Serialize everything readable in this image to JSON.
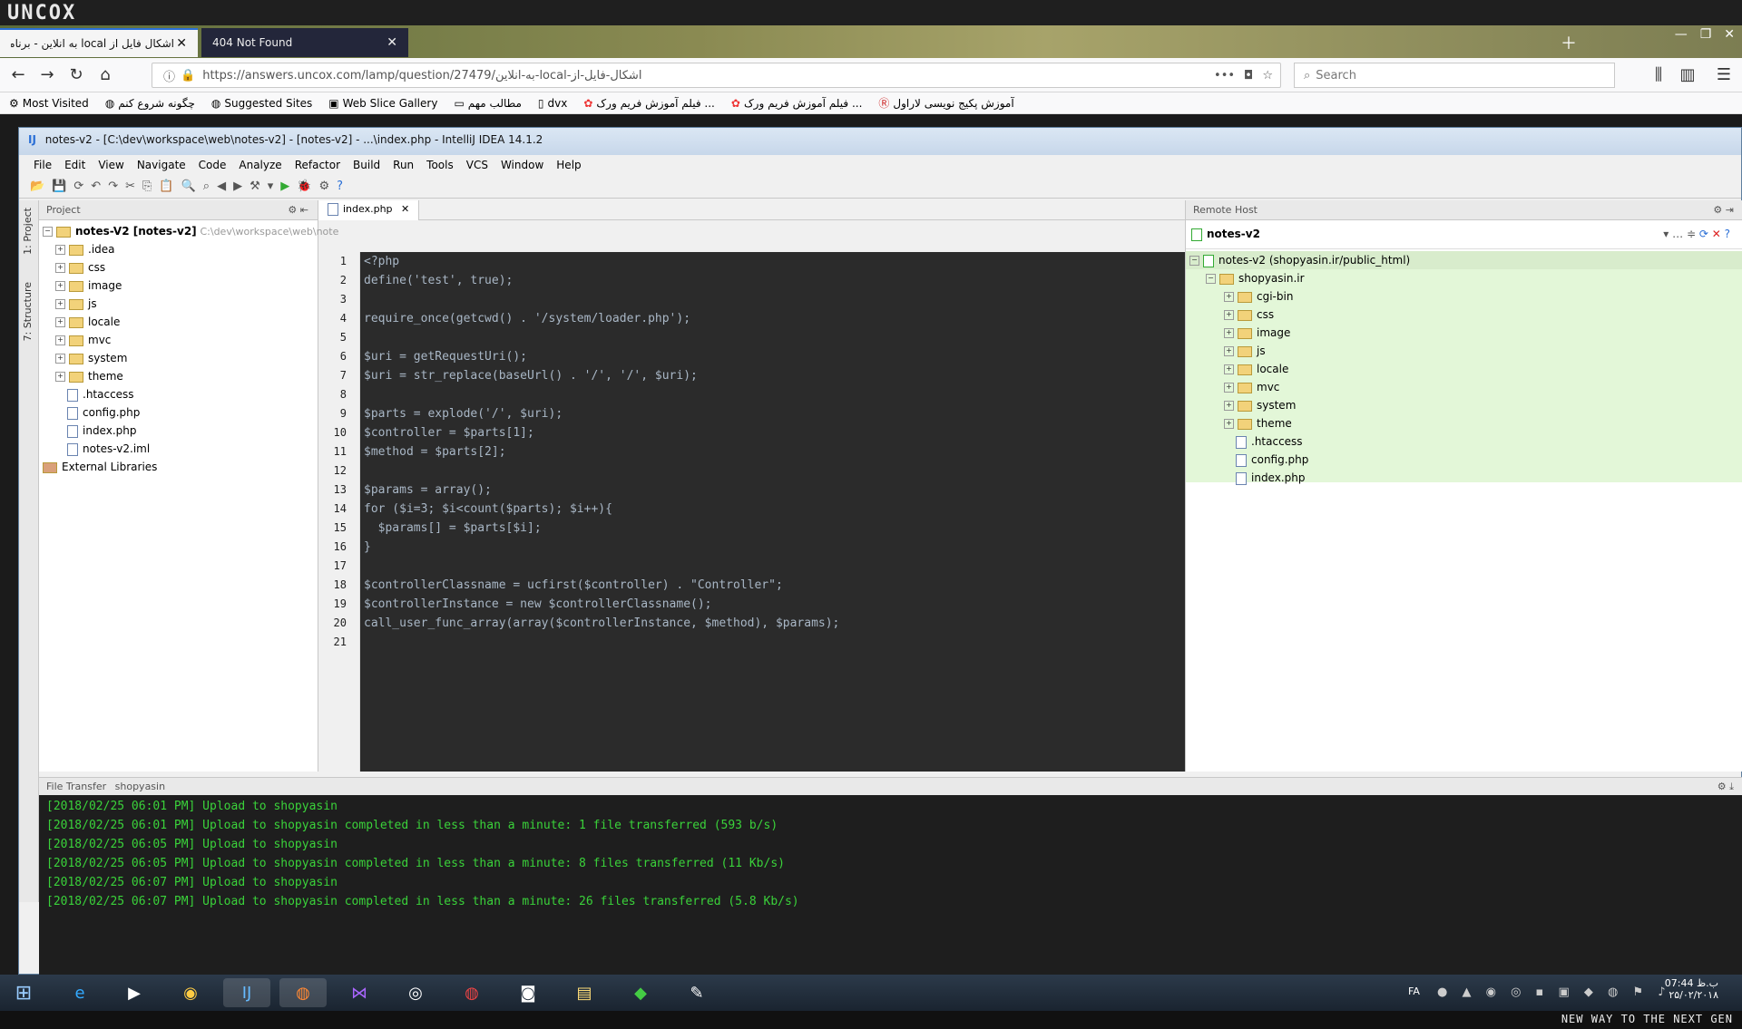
{
  "brand": "UNCOX",
  "browser": {
    "tabs": [
      {
        "title": "اشکال فایل از local به انلاین - برنامه نر",
        "active": true
      },
      {
        "title": "404 Not Found",
        "active": false
      }
    ],
    "url": "https://answers.uncox.com/lamp/question/27479/به-انلاین-local-اشکال-فایل-از",
    "search_placeholder": "Search",
    "bookmarks": [
      "Most Visited",
      "چگونه شروع کنم",
      "Suggested Sites",
      "Web Slice Gallery",
      "مطالب مهم",
      "dvx",
      "فیلم آموزش فریم ورک ...",
      "فیلم آموزش فریم ورک ...",
      "آموزش پکیج نویسی لاراول"
    ]
  },
  "ide": {
    "title": "notes-v2 - [C:\\dev\\workspace\\web\\notes-v2] - [notes-v2] - ...\\index.php - IntelliJ IDEA 14.1.2",
    "menu": [
      "File",
      "Edit",
      "View",
      "Navigate",
      "Code",
      "Analyze",
      "Refactor",
      "Build",
      "Run",
      "Tools",
      "VCS",
      "Window",
      "Help"
    ],
    "project_panel": {
      "header": "Project",
      "root": "notes-V2 [notes-v2]",
      "root_path": "C:\\dev\\workspace\\web\\note",
      "items": [
        {
          "name": ".idea",
          "type": "folder"
        },
        {
          "name": "css",
          "type": "folder"
        },
        {
          "name": "image",
          "type": "folder"
        },
        {
          "name": "js",
          "type": "folder"
        },
        {
          "name": "locale",
          "type": "folder"
        },
        {
          "name": "mvc",
          "type": "folder"
        },
        {
          "name": "system",
          "type": "folder"
        },
        {
          "name": "theme",
          "type": "folder"
        },
        {
          "name": ".htaccess",
          "type": "file"
        },
        {
          "name": "config.php",
          "type": "file"
        },
        {
          "name": "index.php",
          "type": "file"
        },
        {
          "name": "notes-v2.iml",
          "type": "file"
        }
      ],
      "external": "External Libraries"
    },
    "editor_tab": "index.php",
    "code_lines": [
      "<?php",
      "define('test', true);",
      "",
      "require_once(getcwd() . '/system/loader.php');",
      "",
      "$uri = getRequestUri();",
      "$uri = str_replace(baseUrl() . '/', '/', $uri);",
      "",
      "$parts = explode('/', $uri);",
      "$controller = $parts[1];",
      "$method = $parts[2];",
      "",
      "$params = array();",
      "for ($i=3; $i<count($parts); $i++){",
      "  $params[] = $parts[$i];",
      "}",
      "",
      "$controllerClassname = ucfirst($controller) . \"Controller\";",
      "$controllerInstance = new $controllerClassname();",
      "call_user_func_array(array($controllerInstance, $method), $params);",
      ""
    ],
    "remote_panel": {
      "header": "Remote Host",
      "server": "notes-v2",
      "root": "notes-v2 (shopyasin.ir/public_html)",
      "site": "shopyasin.ir",
      "items": [
        {
          "name": "cgi-bin",
          "type": "folder"
        },
        {
          "name": "css",
          "type": "folder"
        },
        {
          "name": "image",
          "type": "folder"
        },
        {
          "name": "js",
          "type": "folder"
        },
        {
          "name": "locale",
          "type": "folder"
        },
        {
          "name": "mvc",
          "type": "folder"
        },
        {
          "name": "system",
          "type": "folder"
        },
        {
          "name": "theme",
          "type": "folder"
        },
        {
          "name": ".htaccess",
          "type": "file"
        },
        {
          "name": "config.php",
          "type": "file"
        },
        {
          "name": "index.php",
          "type": "file"
        }
      ]
    },
    "file_transfer": {
      "header": "File Transfer",
      "target": "shopyasin",
      "log": [
        "[2018/02/25 06:01 PM] Upload to shopyasin",
        "[2018/02/25 06:01 PM] Upload to shopyasin completed in less than a minute: 1 file transferred (593 b/s)",
        "[2018/02/25 06:05 PM] Upload to shopyasin",
        "[2018/02/25 06:05 PM] Upload to shopyasin completed in less than a minute: 8 files transferred (11 Kb/s)",
        "[2018/02/25 06:07 PM] Upload to shopyasin",
        "[2018/02/25 06:07 PM] Upload to shopyasin completed in less than a minute: 26 files transferred (5.8 Kb/s)"
      ]
    }
  },
  "taskbar": {
    "lang": "FA",
    "time": "07:44 ب.ظ",
    "date": "۲۵/۰۲/۲۰۱۸"
  },
  "tagline": "NEW WAY TO THE NEXT GEN"
}
